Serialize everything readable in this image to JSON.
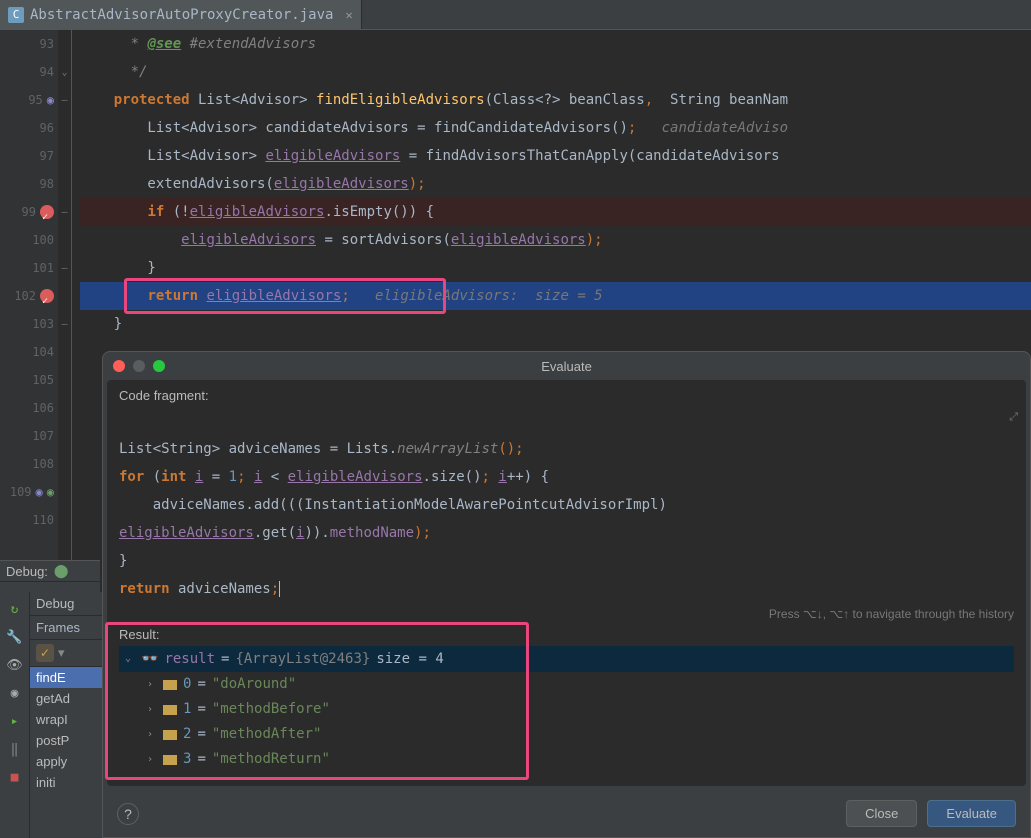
{
  "tab": {
    "filename": "AbstractAdvisorAutoProxyCreator.java",
    "icon_letter": "C"
  },
  "gutter": {
    "lines": [
      "93",
      "94",
      "95",
      "96",
      "97",
      "98",
      "99",
      "100",
      "101",
      "102",
      "103",
      "104",
      "105",
      "106",
      "107",
      "108",
      "109",
      "110"
    ]
  },
  "code": {
    "l93_tag": "@see",
    "l93_rest": " #extendAdvisors",
    "l94": " */",
    "l95_kw": "protected",
    "l95_type": " List<Advisor> ",
    "l95_method": "findEligibleAdvisors",
    "l95_rest": "(Class<?> beanClass",
    "l95_punct": ",",
    "l95_rest2": "  String beanNam",
    "l96_a": "    List<Advisor> candidateAdvisors = findCandidateAdvisors()",
    "l96_p": ";",
    "l96_hint": "   candidateAdviso",
    "l97_a": "    List<Advisor> ",
    "l97_var": "eligibleAdvisors",
    "l97_b": " = findAdvisorsThatCanApply(candidateAdvisors",
    "l98_a": "    extendAdvisors(",
    "l98_var": "eligibleAdvisors",
    "l98_p": ");",
    "l99_if": "if",
    "l99_a": " (!",
    "l99_var": "eligibleAdvisors",
    "l99_b": ".isEmpty()) {",
    "l100_var": "eligibleAdvisors",
    "l100_a": " = sortAdvisors(",
    "l100_var2": "eligibleAdvisors",
    "l100_p": ");",
    "l101": "    }",
    "l102_kw": "return",
    "l102_var": "eligibleAdvisors",
    "l102_p": ";",
    "l102_hint": "   eligibleAdvisors:  size = 5",
    "l103": "}"
  },
  "eval": {
    "title": "Evaluate",
    "code_fragment_label": "Code fragment:",
    "frag_l1_a": "List<String> adviceNames = Lists.",
    "frag_l1_m": "newArrayList",
    "frag_l1_p": "();",
    "frag_l2_for": "for",
    "frag_l2_a": " (",
    "frag_l2_int": "int",
    "frag_l2_b": " ",
    "frag_l2_i": "i",
    "frag_l2_c": " = ",
    "frag_l2_n1": "1",
    "frag_l2_p1": ";",
    "frag_l2_d": " ",
    "frag_l2_i2": "i",
    "frag_l2_e": " < ",
    "frag_l2_ea": "eligibleAdvisors",
    "frag_l2_f": ".size()",
    "frag_l2_p2": ";",
    "frag_l2_g": " ",
    "frag_l2_i3": "i",
    "frag_l2_h": "++) {",
    "frag_l3": "    adviceNames.add(((InstantiationModelAwarePointcutAdvisorImpl) ",
    "frag_l4_ea": "eligibleAdvisors",
    "frag_l4_a": ".get(",
    "frag_l4_i": "i",
    "frag_l4_b": ")).",
    "frag_l4_m": "methodName",
    "frag_l4_p": ");",
    "frag_l5": "}",
    "frag_l6_kw": "return",
    "frag_l6_a": " adviceNames",
    "frag_l6_p": ";",
    "nav_hint": "Press ⌥↓, ⌥↑ to navigate through the history",
    "result_label": "Result:",
    "result_name": "result",
    "result_eq": " = ",
    "result_obj": "{ArrayList@2463}",
    "result_size": "  size = 4",
    "rows": [
      {
        "idx": "0",
        "val": "\"doAround\""
      },
      {
        "idx": "1",
        "val": "\"methodBefore\""
      },
      {
        "idx": "2",
        "val": "\"methodAfter\""
      },
      {
        "idx": "3",
        "val": "\"methodReturn\""
      }
    ],
    "close": "Close",
    "evaluate": "Evaluate"
  },
  "debug": {
    "title": "Debug:",
    "tab_debugger": "Debug",
    "frames_label": "Frames",
    "stack": [
      "findE",
      "getAd",
      "wrapI",
      "postP",
      "apply",
      "initi"
    ]
  }
}
